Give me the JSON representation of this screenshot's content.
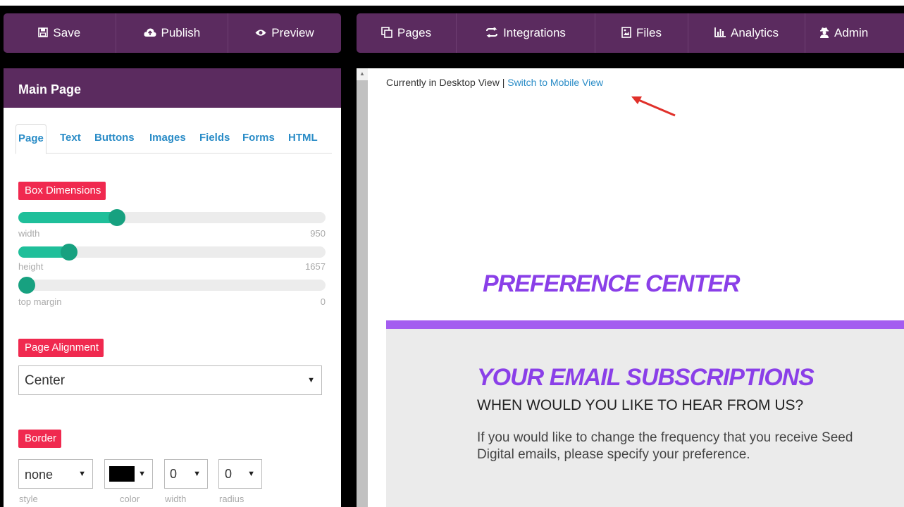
{
  "toolbar_left": {
    "save": "Save",
    "publish": "Publish",
    "preview": "Preview"
  },
  "toolbar_right": {
    "pages": "Pages",
    "integrations": "Integrations",
    "files": "Files",
    "analytics": "Analytics",
    "admin": "Admin"
  },
  "panel": {
    "title": "Main Page",
    "tabs": [
      "Page",
      "Text",
      "Buttons",
      "Images",
      "Fields",
      "Forms",
      "HTML"
    ],
    "box_dimensions": {
      "label": "Box Dimensions",
      "width": {
        "caption": "width",
        "value": "950",
        "fraction": 0.32
      },
      "height": {
        "caption": "height",
        "value": "1657",
        "fraction": 0.165
      },
      "top_margin": {
        "caption": "top margin",
        "value": "0",
        "fraction": 0.0
      }
    },
    "page_alignment": {
      "label": "Page Alignment",
      "value": "Center"
    },
    "border": {
      "label": "Border",
      "style": {
        "value": "none",
        "caption": "style"
      },
      "color": {
        "value": "#000000",
        "caption": "color"
      },
      "width": {
        "value": "0",
        "caption": "width"
      },
      "radius": {
        "value": "0",
        "caption": "radius"
      }
    }
  },
  "canvas": {
    "view_status": "Currently in Desktop View |",
    "switch_link": "Switch to Mobile View",
    "preference_title": "PREFERENCE CENTER",
    "subscriptions_title": "YOUR EMAIL SUBSCRIPTIONS",
    "subscriptions_heading": "WHEN WOULD YOU LIKE TO HEAR FROM US?",
    "subscriptions_body": "If you would like to change the frequency that you receive Seed Digital emails, please specify your preference."
  },
  "colors": {
    "toolbar": "#5b2b5f",
    "label_red": "#f0294f",
    "slider_fill": "#1fbf9a",
    "accent_purple": "#8a3fe8"
  }
}
